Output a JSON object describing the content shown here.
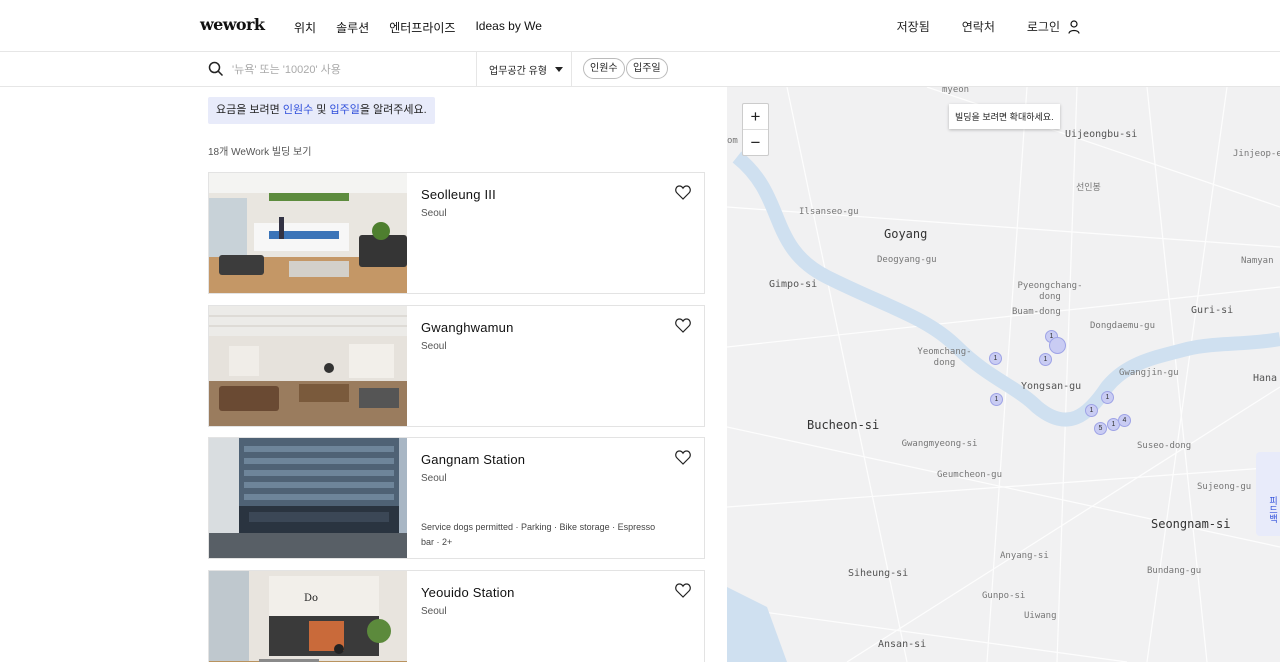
{
  "header": {
    "logo": "wework",
    "nav": [
      "위치",
      "솔루션",
      "엔터프라이즈",
      "Ideas by We"
    ],
    "saved": "저장됨",
    "contact": "연락처",
    "login": "로그인"
  },
  "search": {
    "placeholder": "'뉴욕' 또는 '10020' 사용",
    "type_select": "업무공간 유형",
    "people_pill": "인원수",
    "date_pill": "입주일"
  },
  "listing": {
    "notice_pre": "요금을 보려면 ",
    "notice_link1": "인원수",
    "notice_mid": " 및 ",
    "notice_link2": "입주일",
    "notice_post": "을 알려주세요.",
    "count": "18개 WeWork 빌딩 보기",
    "cards": [
      {
        "title": "Seolleung III",
        "city": "Seoul",
        "amenities": ""
      },
      {
        "title": "Gwanghwamun",
        "city": "Seoul",
        "amenities": ""
      },
      {
        "title": "Gangnam Station",
        "city": "Seoul",
        "amenities": "Service dogs permitted · Parking · Bike storage · Espresso bar · 2+"
      },
      {
        "title": "Yeouido Station",
        "city": "Seoul",
        "amenities": ""
      }
    ]
  },
  "map": {
    "tip": "빌딩을 보려면 확대하세요.",
    "zoom_in": "+",
    "zoom_out": "−",
    "side_tab": "피드백",
    "labels": [
      "myeon",
      "Uijeongbu-si",
      "Jinjeop-e",
      "선인봉",
      "Ilsanseo-gu",
      "Goyang",
      "Deogyang-gu",
      "Namyan",
      "Gimpo-si",
      "Pyeongchang-dong",
      "Buam-dong",
      "Guri-si",
      "Dongdaemu-gu",
      "Yeomchang-dong",
      "Yongsan-gu",
      "Gwangjin-gu",
      "Hana",
      "Bucheon-si",
      "Gwangmyeong-si",
      "Suseo-dong",
      "Geumcheon-gu",
      "Sujeong-gu",
      "Seongnam-si",
      "Anyang-si",
      "Siheung-si",
      "Bundang-gu",
      "Gunpo-si",
      "Uiwang",
      "Ansan-si",
      "om"
    ],
    "markers": [
      "1",
      "1",
      "1",
      "",
      "1",
      "1",
      "1",
      "1",
      "4",
      "5"
    ]
  },
  "colors": {
    "accent": "#2f4fdb",
    "notice_bg": "#e8ebfa",
    "river": "#cfe0f0",
    "marker": "#c9ccf3"
  }
}
